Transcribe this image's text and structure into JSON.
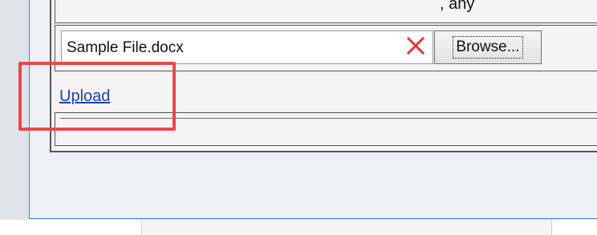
{
  "header": {
    "partial_text": ", any"
  },
  "file_upload": {
    "file_name_value": "Sample File.docx",
    "clear_icon": "close-icon",
    "clear_color": "#e8353a",
    "browse_label": "Browse...",
    "upload_label": "Upload"
  },
  "annotation": {
    "highlight_color": "#e8494d"
  }
}
